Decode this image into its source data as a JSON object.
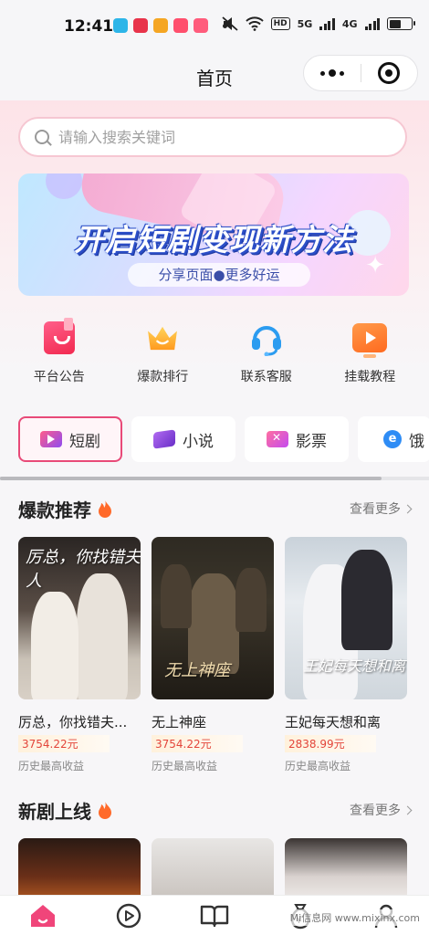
{
  "status_bar": {
    "time": "12:41",
    "network_badges": [
      "HD",
      "5G",
      "4G"
    ],
    "app_icon_colors": [
      "#2db5e8",
      "#e8334a",
      "#f5a623",
      "#ff4f6d",
      "#ff5c7c"
    ]
  },
  "nav": {
    "title": "首页",
    "more_icon": "more-dots-icon",
    "close_icon": "target-circle-icon"
  },
  "search": {
    "placeholder": "请输入搜索关键词",
    "icon": "search-icon"
  },
  "banner": {
    "title": "开启短剧变现新方法",
    "subtitle": "分享页面●更多好运"
  },
  "quick_links": [
    {
      "label": "平台公告",
      "icon": "notice-icon"
    },
    {
      "label": "爆款排行",
      "icon": "crown-icon"
    },
    {
      "label": "联系客服",
      "icon": "headset-icon"
    },
    {
      "label": "挂载教程",
      "icon": "tv-play-icon"
    }
  ],
  "category_tabs": [
    {
      "label": "短剧",
      "icon": "video-icon",
      "active": true
    },
    {
      "label": "小说",
      "icon": "book-icon",
      "active": false
    },
    {
      "label": "影票",
      "icon": "ticket-icon",
      "active": false
    },
    {
      "label": "饿",
      "icon": "eleme-icon",
      "active": false
    }
  ],
  "hot_section": {
    "title": "爆款推荐",
    "more": "查看更多",
    "items": [
      {
        "name": "厉总，你找错夫...",
        "price": "3754.22元",
        "note": "历史最高收益",
        "poster_text": "厉总，你找错夫人"
      },
      {
        "name": "无上神座",
        "price": "3754.22元",
        "note": "历史最高收益",
        "poster_text": "无上神座"
      },
      {
        "name": "王妃每天想和离",
        "price": "2838.99元",
        "note": "历史最高收益",
        "poster_text": "王妃每天想和离"
      }
    ]
  },
  "new_section": {
    "title": "新剧上线",
    "more": "查看更多"
  },
  "tabbar": {
    "items": [
      "home-icon",
      "play-icon",
      "book-open-icon",
      "money-bag-icon",
      "profile-icon"
    ],
    "active_color": "#f0457a"
  },
  "watermark": "Mi信息网 www.mixinx.com",
  "colors": {
    "accent": "#e84a78",
    "price": "#e3453a"
  }
}
